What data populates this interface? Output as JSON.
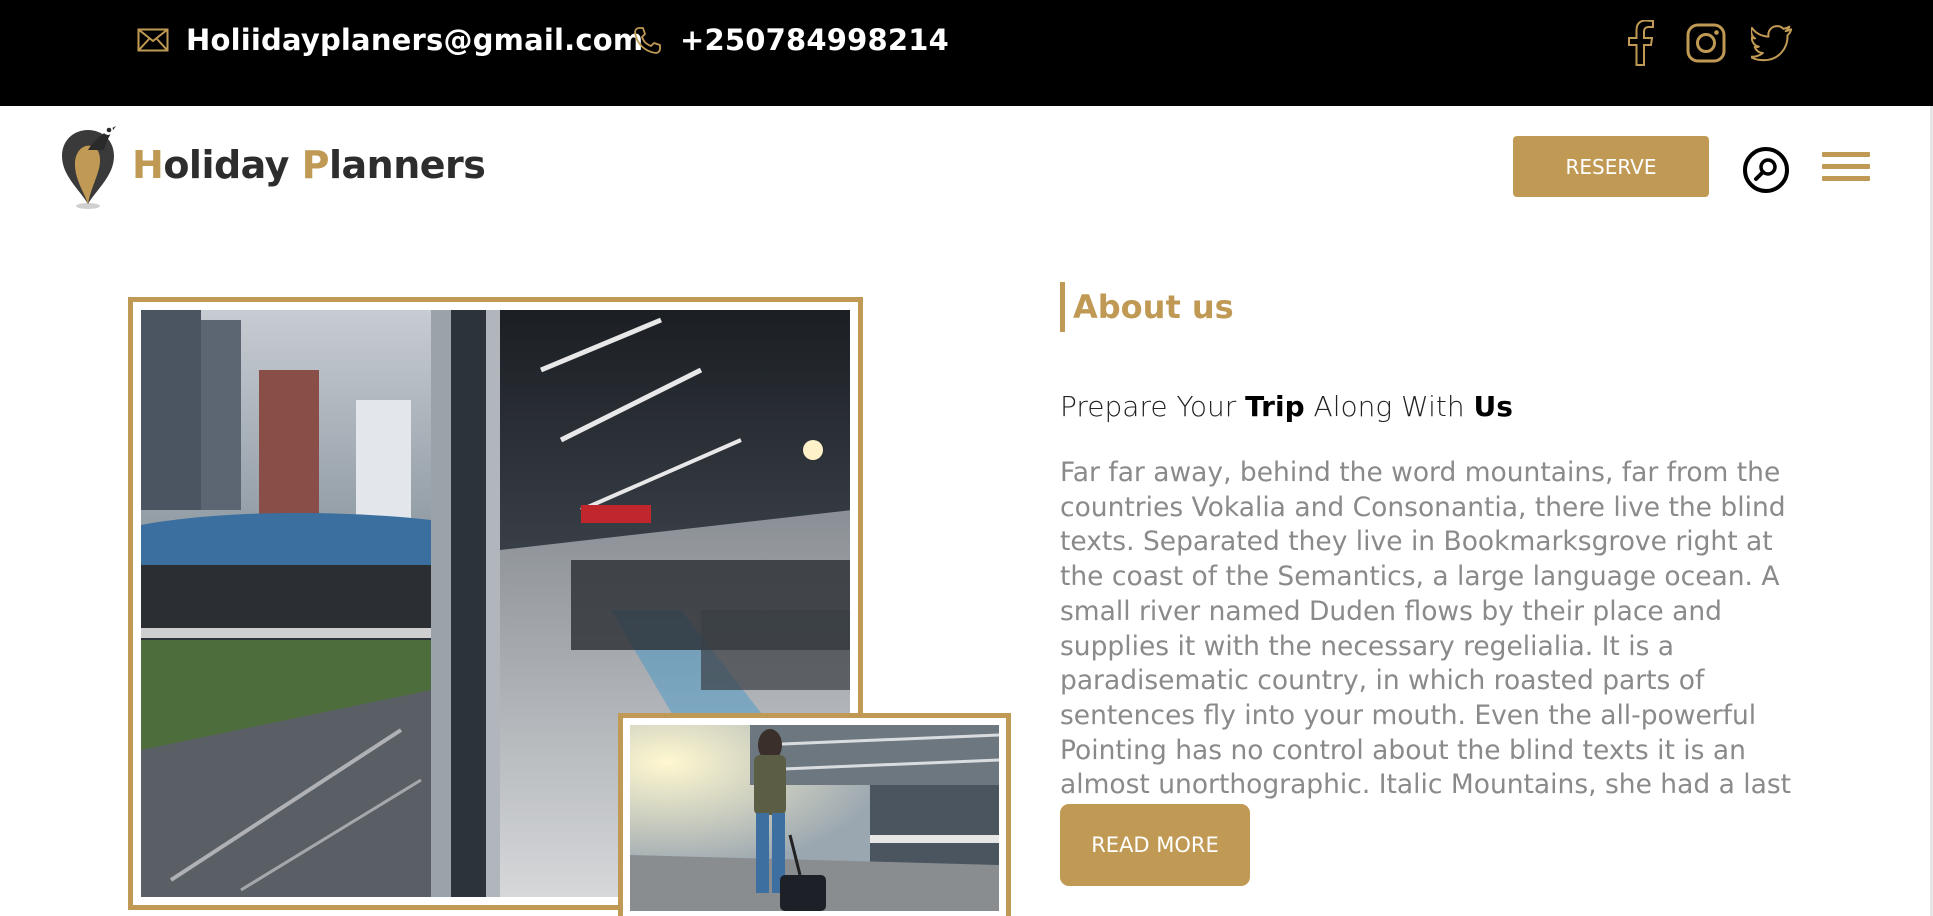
{
  "topbar": {
    "email": "Holiidayplaners@gmail.com",
    "phone": "+250784998214",
    "socials": [
      "facebook-icon",
      "instagram-icon",
      "twitter-icon"
    ]
  },
  "header": {
    "brand_first_cap": "H",
    "brand_first_rest": "oliday ",
    "brand_second_cap": "P",
    "brand_second_rest": "lanners",
    "reserve_label": "RESERVE"
  },
  "about": {
    "heading": "About us",
    "tagline_parts": [
      "Prepare Your ",
      "Trip",
      " Along With ",
      "Us"
    ],
    "paragraph": "Far far away, behind the word mountains, far from the countries Vokalia and Consonantia, there live the blind texts. Separated they live in Bookmarksgrove right at the coast of the Semantics, a large language ocean. A small river named Duden flows by their place and supplies it with the necessary regelialia. It is a paradisematic country, in which roasted parts of sentences fly into your mouth. Even the all-powerful Pointing has no control about the blind texts it is an almost unorthographic. Italic Mountains, she had a last view back on the skyline",
    "read_more": "READ MORE"
  },
  "colors": {
    "accent": "#c09a54",
    "topbar_bg": "#000000",
    "text_gray": "#8a8a8a"
  }
}
